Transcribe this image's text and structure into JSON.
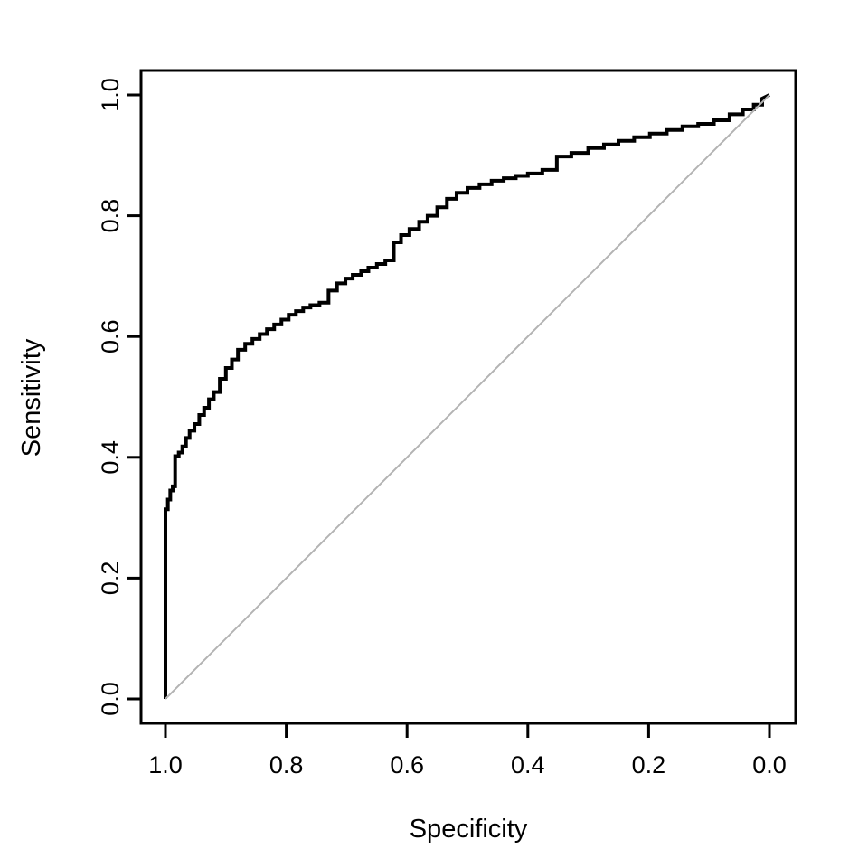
{
  "chart_data": {
    "type": "line",
    "title": "",
    "subtitle": "",
    "xlabel": "Specificity",
    "ylabel": "Sensitivity",
    "xlim": [
      1.0,
      0.0
    ],
    "ylim": [
      0.0,
      1.0
    ],
    "x_reversed": true,
    "grid": false,
    "legend": null,
    "legend_position": "none",
    "xticks": [
      "1.0",
      "0.8",
      "0.6",
      "0.4",
      "0.2",
      "0.0"
    ],
    "xtick_values": [
      1.0,
      0.8,
      0.6,
      0.4,
      0.2,
      0.0
    ],
    "yticks": [
      "0.0",
      "0.2",
      "0.4",
      "0.6",
      "0.8",
      "1.0"
    ],
    "ytick_values": [
      0.0,
      0.2,
      0.4,
      0.6,
      0.8,
      1.0
    ],
    "series": [
      {
        "name": "ROC curve",
        "color": "#000000",
        "linewidth": 4,
        "style": "step",
        "x": [
          1.0,
          1.0,
          0.996,
          0.996,
          0.992,
          0.992,
          0.988,
          0.988,
          0.984,
          0.984,
          0.978,
          0.978,
          0.972,
          0.972,
          0.966,
          0.966,
          0.96,
          0.96,
          0.952,
          0.952,
          0.944,
          0.944,
          0.936,
          0.936,
          0.928,
          0.928,
          0.92,
          0.92,
          0.91,
          0.91,
          0.9,
          0.9,
          0.89,
          0.89,
          0.88,
          0.88,
          0.868,
          0.868,
          0.856,
          0.856,
          0.844,
          0.844,
          0.832,
          0.832,
          0.82,
          0.82,
          0.808,
          0.808,
          0.796,
          0.796,
          0.784,
          0.784,
          0.772,
          0.772,
          0.76,
          0.76,
          0.745,
          0.745,
          0.73,
          0.73,
          0.716,
          0.716,
          0.702,
          0.702,
          0.69,
          0.69,
          0.676,
          0.676,
          0.664,
          0.664,
          0.65,
          0.65,
          0.636,
          0.636,
          0.622,
          0.622,
          0.61,
          0.61,
          0.596,
          0.596,
          0.58,
          0.58,
          0.566,
          0.566,
          0.55,
          0.55,
          0.534,
          0.534,
          0.518,
          0.518,
          0.5,
          0.5,
          0.48,
          0.48,
          0.46,
          0.46,
          0.44,
          0.44,
          0.42,
          0.42,
          0.4,
          0.4,
          0.376,
          0.376,
          0.352,
          0.352,
          0.328,
          0.328,
          0.3,
          0.3,
          0.274,
          0.274,
          0.25,
          0.25,
          0.224,
          0.224,
          0.198,
          0.198,
          0.17,
          0.17,
          0.144,
          0.144,
          0.118,
          0.118,
          0.092,
          0.092,
          0.066,
          0.066,
          0.044,
          0.044,
          0.026,
          0.026,
          0.012,
          0.012,
          0.0
        ],
        "y": [
          0.0,
          0.314,
          0.314,
          0.33,
          0.33,
          0.345,
          0.345,
          0.352,
          0.352,
          0.402,
          0.402,
          0.408,
          0.408,
          0.418,
          0.418,
          0.432,
          0.432,
          0.444,
          0.444,
          0.455,
          0.455,
          0.47,
          0.47,
          0.482,
          0.482,
          0.496,
          0.496,
          0.508,
          0.508,
          0.53,
          0.53,
          0.548,
          0.548,
          0.562,
          0.562,
          0.578,
          0.578,
          0.588,
          0.588,
          0.596,
          0.596,
          0.604,
          0.604,
          0.612,
          0.612,
          0.62,
          0.62,
          0.628,
          0.628,
          0.636,
          0.636,
          0.642,
          0.642,
          0.648,
          0.648,
          0.652,
          0.652,
          0.656,
          0.656,
          0.676,
          0.676,
          0.688,
          0.688,
          0.696,
          0.696,
          0.702,
          0.702,
          0.708,
          0.708,
          0.714,
          0.714,
          0.72,
          0.72,
          0.726,
          0.726,
          0.756,
          0.756,
          0.768,
          0.768,
          0.778,
          0.778,
          0.79,
          0.79,
          0.8,
          0.8,
          0.814,
          0.814,
          0.828,
          0.828,
          0.838,
          0.838,
          0.846,
          0.846,
          0.852,
          0.852,
          0.858,
          0.858,
          0.862,
          0.862,
          0.866,
          0.866,
          0.87,
          0.87,
          0.876,
          0.876,
          0.898,
          0.898,
          0.904,
          0.904,
          0.912,
          0.912,
          0.918,
          0.918,
          0.924,
          0.924,
          0.93,
          0.93,
          0.936,
          0.936,
          0.942,
          0.942,
          0.948,
          0.948,
          0.952,
          0.952,
          0.958,
          0.958,
          0.968,
          0.968,
          0.976,
          0.976,
          0.984,
          0.984,
          0.994,
          1.0
        ]
      },
      {
        "name": "chance diagonal",
        "color": "#b3b3b3",
        "linewidth": 2,
        "style": "line",
        "x": [
          1.0,
          0.0
        ],
        "y": [
          0.0,
          1.0
        ]
      }
    ]
  },
  "axes": {
    "x_axis_label": "Specificity",
    "y_axis_label": "Sensitivity"
  }
}
